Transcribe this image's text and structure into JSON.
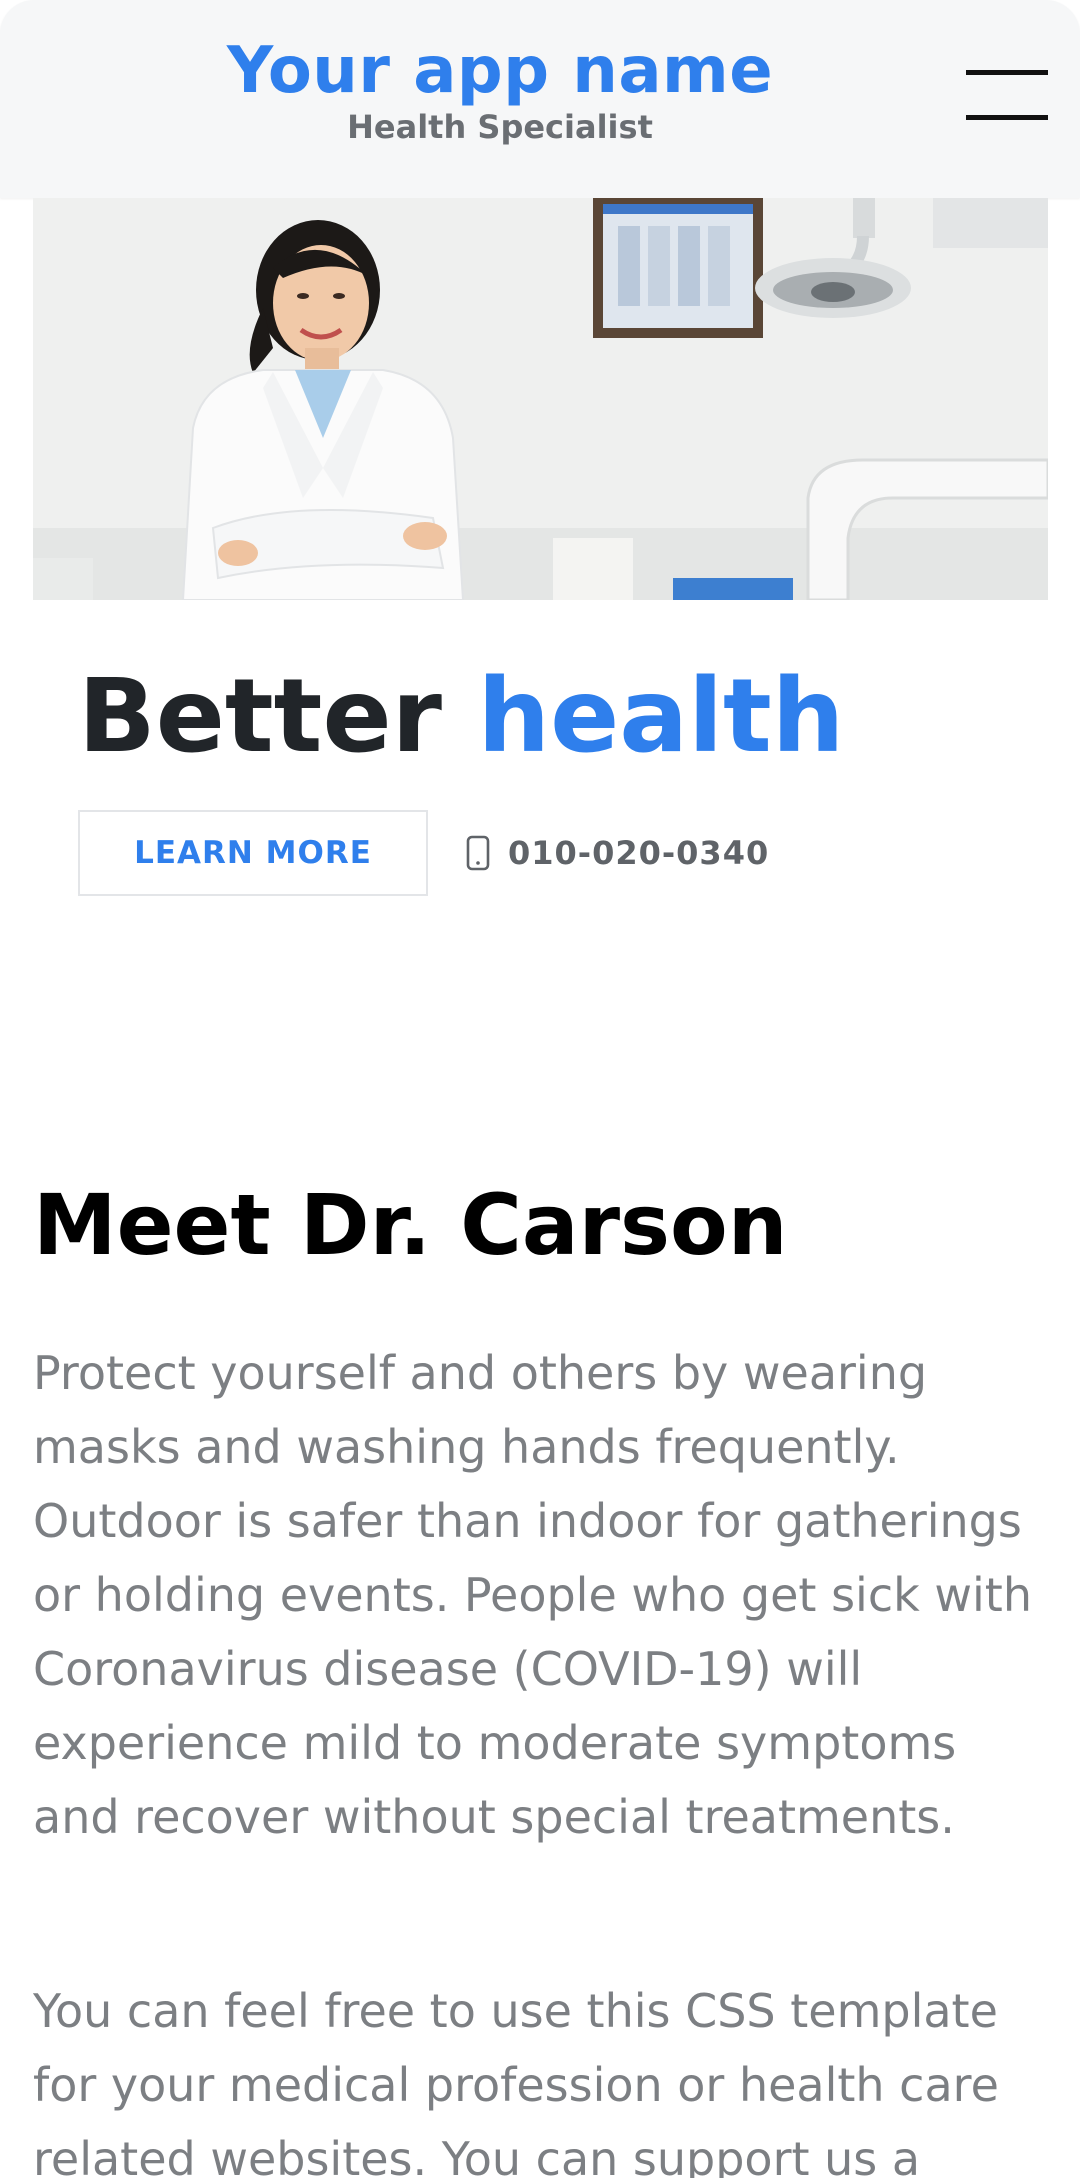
{
  "header": {
    "app_name": "Your app name",
    "tagline": "Health Specialist",
    "menu_icon": "hamburger-menu-icon"
  },
  "hero": {
    "image": "doctor-in-clinic-photo",
    "heading_main": "Better",
    "heading_accent": "health",
    "cta_label": "LEARN MORE",
    "phone_icon": "mobile-phone-icon",
    "phone_number": "010-020-0340"
  },
  "about": {
    "title": "Meet Dr. Carson",
    "paragraph_1": "Protect yourself and others by wearing masks and washing hands frequently. Outdoor is safer than indoor for gatherings or holding events. People who get sick with Coronavirus disease (COVID-19) will experience mild to moderate symptoms and recover without special treatments.",
    "paragraph_2": "You can feel free to use this CSS template for your medical profession or health care related websites. You can support us a"
  },
  "colors": {
    "accent": "#2f7fec",
    "heading": "#212529",
    "body_text": "#7c7f83",
    "header_bg": "#f6f7f8"
  }
}
